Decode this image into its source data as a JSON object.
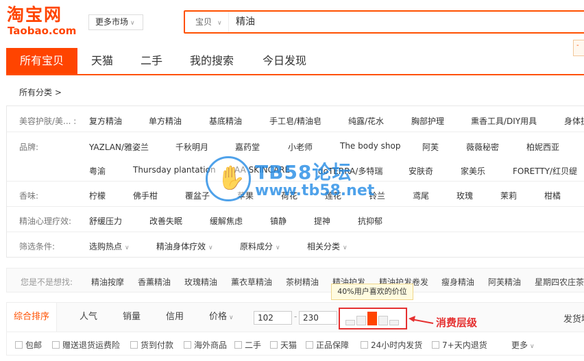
{
  "logo": {
    "cn": "淘宝网",
    "en": "Taobao.com"
  },
  "market_button": "更多市场",
  "search": {
    "type": "宝贝",
    "query": "精油"
  },
  "tabs": [
    "所有宝贝",
    "天猫",
    "二手",
    "我的搜索",
    "今日发现"
  ],
  "all_category": "所有分类 >",
  "filters": {
    "category": {
      "label": "美容护肤/美... :",
      "items": [
        "复方精油",
        "单方精油",
        "基底精油",
        "手工皂/精油皂",
        "纯露/花水",
        "胸部护理",
        "熏香工具/DIY用具",
        "身体护"
      ]
    },
    "brand": {
      "label": "品牌:",
      "items_row1": [
        "YAZLAN/雅姿兰",
        "千秋明月",
        "嘉药堂",
        "小老师",
        "The body shop",
        "阿芙",
        "薇薇秘密",
        "柏妮西亚"
      ],
      "items_row2": [
        "粤渝",
        "Thursday plantation",
        "AA SKINCARE",
        "doTERRA/多特瑞",
        "安肤奇",
        "家美乐",
        "FORETTY/红贝缇"
      ]
    },
    "scent": {
      "label": "香味:",
      "items": [
        "柠檬",
        "佛手柑",
        "覆盆子",
        "苹果",
        "荷花",
        "莲花",
        "铃兰",
        "鸢尾",
        "玫瑰",
        "茉莉",
        "柑橘"
      ]
    },
    "therapy": {
      "label": "精油心理疗效:",
      "items": [
        "舒缓压力",
        "改善失眠",
        "缓解焦虑",
        "镇静",
        "提神",
        "抗抑郁"
      ]
    },
    "condition": {
      "label": "筛选条件:",
      "items": [
        "选购热点",
        "精油身体疗效",
        "原料成分",
        "相关分类"
      ]
    }
  },
  "suggestions": {
    "label": "您是不是想找:",
    "items": [
      "精油按摩",
      "香薰精油",
      "玫瑰精油",
      "薰衣草精油",
      "茶树精油",
      "精油护发",
      "精油护发卷发",
      "瘦身精油",
      "阿芙精油",
      "星期四农庄茶"
    ]
  },
  "tooltip": "40%用户喜欢的价位",
  "sort": {
    "items": [
      "综合排序",
      "人气",
      "销量",
      "信用",
      "价格"
    ],
    "price_min": "102",
    "price_max": "230",
    "ship_from": "发货地"
  },
  "level_note": "消费层级",
  "checkboxes": [
    "包邮",
    "赠送退货运费险",
    "货到付款",
    "海外商品",
    "二手",
    "天猫",
    "正品保障",
    "24小时内发货",
    "7+天内退货"
  ],
  "more": "更多",
  "watermark": {
    "title": "TB58论坛",
    "url": "www.tb58.net"
  },
  "colors": {
    "accent": "#ff4400",
    "note": "#e53030",
    "watermark": "#1e88e5"
  }
}
